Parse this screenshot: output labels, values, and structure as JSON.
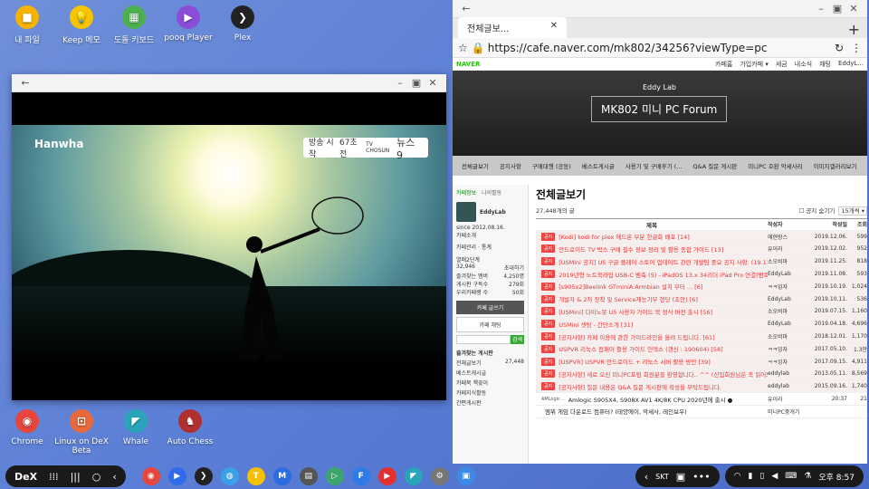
{
  "desktop_top": [
    {
      "label": "내 파일",
      "color": "#f6b400",
      "glyph": "■"
    },
    {
      "label": "Keep 메모",
      "color": "#f6c500",
      "glyph": "💡"
    },
    {
      "label": "도돌 키보드",
      "color": "#4caf50",
      "glyph": "▦"
    },
    {
      "label": "pooq Player",
      "color": "#8a4dd8",
      "glyph": "▶"
    },
    {
      "label": "Plex",
      "color": "#222",
      "glyph": "❯"
    }
  ],
  "desktop_bottom": [
    {
      "label": "Chrome",
      "color": "#e8453c",
      "glyph": "◉"
    },
    {
      "label": "Linux on DeX Beta",
      "color": "#e86a3c",
      "glyph": "⊡"
    },
    {
      "label": "Whale",
      "color": "#2aa4b8",
      "glyph": "◤"
    },
    {
      "label": "Auto Chess",
      "color": "#b03030",
      "glyph": "♞"
    }
  ],
  "video": {
    "brand": "Hanwha",
    "overlay_label": "방송 시작",
    "overlay_num": "67초 전",
    "overlay_src": "TV CHOSUN",
    "overlay_title": "뉴스 9"
  },
  "browser": {
    "tab": "전체글보...",
    "url": "https://cafe.naver.com/mk802/34256?viewType=pc",
    "naver": "NAVER",
    "topnav": [
      "카페홈",
      "가입카페 ▾",
      "세금",
      "내소식",
      "채팅",
      "EddyL..."
    ],
    "banner_small": "Eddy Lab",
    "banner_title": "MK802 미니 PC Forum",
    "menu": [
      "전체글보기",
      "공지사항",
      "구매대행 (공동)",
      "베스트게시글",
      "사용기 및 구매후기 (...",
      "Q&A 질문 게시판",
      "미니PC 호환 악세사리",
      "이미지갤러리보기"
    ],
    "side": {
      "tab1": "카페정보",
      "tab2": "나의활동",
      "user": "EddyLab",
      "since": "since 2012.08.16.",
      "intro": "카페소개",
      "manage": "카페관리",
      "stats": "통계",
      "rank": "열매2단계",
      "members": "32,946",
      "invite": "초대하기",
      "fav": "즐겨찾는 멤버",
      "fav_n": "4,250명",
      "sub": "게시판 구독수",
      "sub_n": "279회",
      "pop": "우리카페랭 수",
      "pop_n": "50회",
      "write_btn": "카페 글쓰기",
      "chat_btn": "카페 채팅",
      "search_btn": "검색",
      "board_head": "즐겨찾는 게시판",
      "boards": [
        [
          "전체글보기",
          "27,448"
        ],
        [
          "베스트게시글",
          ""
        ],
        [
          "카페북 책꽂이",
          ""
        ],
        [
          "카페지식활동",
          ""
        ],
        [
          "간편게시판",
          ""
        ]
      ]
    },
    "main": {
      "heading": "전체글보기",
      "count": "27,448개의 글",
      "chk": "공지 숨기기",
      "per": "15개씩 ▾",
      "cols": [
        "제목",
        "작성자",
        "작성일",
        "조회"
      ],
      "rows": [
        [
          "공지",
          "[Kodi] kodi for plex 에드온 부분 한글화 배포 [14]",
          "애현랑스",
          "2019.12.06.",
          "599"
        ],
        [
          "공지",
          "안드로이드 TV 박스 구매 필수 정보 정리 및 활용 종합 가이드 [13]",
          "유이라",
          "2019.12.02.",
          "952"
        ],
        [
          "공지",
          "[USMini 공지] U5 구글 플레이 스토어 업데이트 관련 개발팀 중요 공지 사항. (19.11.25) [17]",
          "소오비마",
          "2019.11.25.",
          "818"
        ],
        [
          "공지",
          "2019년형 노트북라입 USB-C 뱀축 (5) - iPadOS 13.x 34리더 iPad Pro 연결(범독 키보드 & 터치마우스 사용가능) [3]",
          "EddyLab",
          "2019.11.08.",
          "593"
        ],
        [
          "공지",
          "[s905x2]Beelink GTminiA Armbian 설치 부터 ... [6]",
          "ㅋㅋ잉자",
          "2019.10.19.",
          "1,024"
        ],
        [
          "공지",
          "개발자 & 2차 장착 및 Service재능기부 현당 (초안) [6]",
          "EddyLab",
          "2019.10.11.",
          "536"
        ],
        [
          "공지",
          "[USMini] 다이노봇 U5 사용자 가이드 북 정식 버전 출시 [56]",
          "소오비마",
          "2019.07.15.",
          "1,160"
        ],
        [
          "공지",
          "USMini 셋팅 - 간단소개 [31]",
          "EddyLab",
          "2019.04.18.",
          "4,696"
        ],
        [
          "공지",
          "[공지사항] 카페 이용에 관한 가이드라인을 올려 드립니다. [61]",
          "소오비마",
          "2018.12.01.",
          "1,170"
        ],
        [
          "공지",
          "USPVR 리눅스 컴패어 활용 가이드 인덱스 (갱신 : 190604) [58]",
          "ㅋㅋ잉자",
          "2017.05.10.",
          "1.3만"
        ],
        [
          "공지",
          "[USPVR] USPVR 안드로이드 + 리눅스 서버 활용 방안 [39]",
          "ㅋㅋ잉자",
          "2017.09.15.",
          "4,911"
        ],
        [
          "공지",
          "[공지사항] 새로 오신 미니PC포럼 회원분들 환영합니다.. ^^ (신입회원님은 꼭 읽어봐 주시기 바랍니다. ) [374]",
          "eddylab",
          "2013.05.11.",
          "8,569"
        ],
        [
          "공지",
          "[공지사항] 질문 내용은 Q&A 질문 게시판에 작성을 부탁드립니다.",
          "eddylab",
          "2015.09.16.",
          "1,740"
        ],
        [
          "AMLogic ..",
          "Amlogic S905X4, S908X AV1 4K/8K CPU 2020년에 출시 ●",
          "유이라",
          "20:37",
          "21"
        ],
        [
          "",
          "엠뷔 게임 다운로드 컴퓨터? (태양에이, 악세사, 레인보우)",
          "미니PC중개기",
          "",
          ""
        ]
      ]
    }
  },
  "taskbar": {
    "dex": "DeX",
    "time": "오후 8:57",
    "left_apps": [
      {
        "c": "#e8453c",
        "g": "◉"
      },
      {
        "c": "#2f6bea",
        "g": "▶"
      },
      {
        "c": "#222",
        "g": "❯"
      },
      {
        "c": "#3aa0e8",
        "g": "◍"
      },
      {
        "c": "#f5c000",
        "g": "T"
      },
      {
        "c": "#2d6be0",
        "g": "M"
      },
      {
        "c": "#555",
        "g": "▤"
      },
      {
        "c": "#3ca56b",
        "g": "▷"
      },
      {
        "c": "#2d7be8",
        "g": "F"
      },
      {
        "c": "#e53030",
        "g": "▶"
      },
      {
        "c": "#2aa4b8",
        "g": "◤"
      },
      {
        "c": "#777",
        "g": "⚙"
      },
      {
        "c": "#3c8be8",
        "g": "▣"
      }
    ],
    "right_label": "SKT"
  }
}
